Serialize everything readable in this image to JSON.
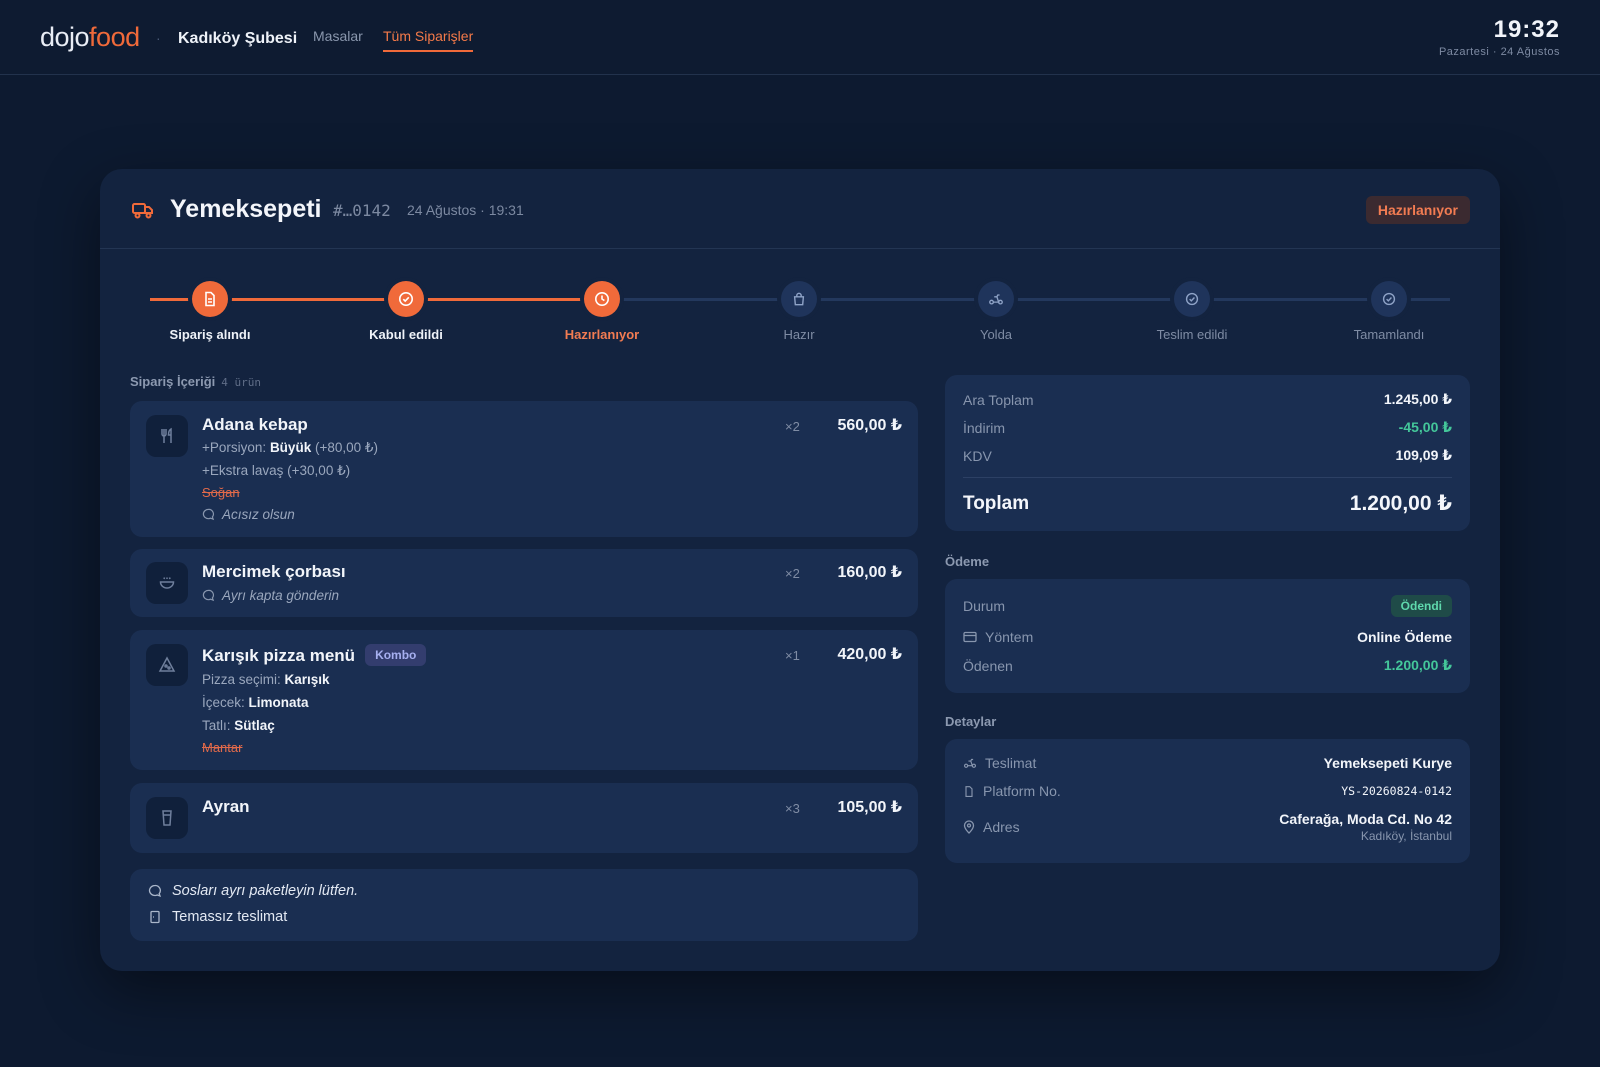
{
  "header": {
    "brand_part1": "dojo",
    "brand_part2": "food",
    "separator": "·",
    "branch": "Kadıköy Şubesi",
    "nav": [
      {
        "label": "Masalar",
        "active": false
      },
      {
        "label": "Tüm Siparişler",
        "active": true
      }
    ],
    "time": "19:32",
    "date": "Pazartesi · 24 Ağustos"
  },
  "order": {
    "platform": "Yemeksepeti",
    "platform_icon": "truck-icon",
    "number": "#…0142",
    "datetime": "24 Ağustos · 19:31",
    "status": "Hazırlanıyor",
    "accent_color": "#f06a3a"
  },
  "steps": [
    {
      "label": "Sipariş alındı",
      "state": "done",
      "icon": "document-icon"
    },
    {
      "label": "Kabul edildi",
      "state": "done",
      "icon": "check-circle-icon"
    },
    {
      "label": "Hazırlanıyor",
      "state": "active",
      "icon": "clock-icon"
    },
    {
      "label": "Hazır",
      "state": "todo",
      "icon": "bag-icon"
    },
    {
      "label": "Yolda",
      "state": "todo",
      "icon": "scooter-icon"
    },
    {
      "label": "Teslim edildi",
      "state": "todo",
      "icon": "check-circle-icon"
    },
    {
      "label": "Tamamlandı",
      "state": "todo",
      "icon": "check-circle-icon"
    }
  ],
  "content": {
    "title": "Sipariş İçeriği",
    "count": "4 ürün",
    "items": [
      {
        "name": "Adana kebap",
        "qty": "×2",
        "price": "560,00 ₺",
        "icon": "utensils-icon",
        "mod1_prefix": "+Porsiyon:",
        "mod1_value": "Büyük",
        "mod1_extra": "(+80,00 ₺)",
        "mod2": "+Ekstra lavaş (+30,00 ₺)",
        "removed": "Soğan",
        "note": "Acısız olsun"
      },
      {
        "name": "Mercimek çorbası",
        "qty": "×2",
        "price": "160,00 ₺",
        "icon": "bowl-icon",
        "note": "Ayrı kapta gönderin"
      },
      {
        "name": "Karışık pizza menü",
        "badge": "Kombo",
        "qty": "×1",
        "price": "420,00 ₺",
        "icon": "pizza-icon",
        "c1_k": "Pizza seçimi:",
        "c1_v": "Karışık",
        "c2_k": "İçecek:",
        "c2_v": "Limonata",
        "c3_k": "Tatlı:",
        "c3_v": "Sütlaç",
        "removed": "Mantar"
      },
      {
        "name": "Ayran",
        "qty": "×3",
        "price": "105,00 ₺",
        "icon": "cup-icon"
      }
    ],
    "order_note": "Sosları ayrı paketleyin lütfen.",
    "contactless": "Temassız teslimat"
  },
  "totals": {
    "subtotal_k": "Ara Toplam",
    "subtotal_v": "1.245,00 ₺",
    "discount_k": "İndirim",
    "discount_v": "-45,00 ₺",
    "tax_k": "KDV",
    "tax_v": "109,09 ₺",
    "total_k": "Toplam",
    "total_v": "1.200,00 ₺"
  },
  "payment": {
    "title": "Ödeme",
    "status_k": "Durum",
    "status_v": "Ödendi",
    "method_k": "Yöntem",
    "method_v": "Online Ödeme",
    "paid_k": "Ödenen",
    "paid_v": "1.200,00 ₺"
  },
  "details": {
    "title": "Detaylar",
    "delivery_k": "Teslimat",
    "delivery_v": "Yemeksepeti Kurye",
    "platform_no_k": "Platform No.",
    "platform_no_v": "YS-20260824-0142",
    "address_k": "Adres",
    "address_line1": "Caferağa, Moda Cd. No 42",
    "address_line2": "Kadıköy, İstanbul"
  }
}
